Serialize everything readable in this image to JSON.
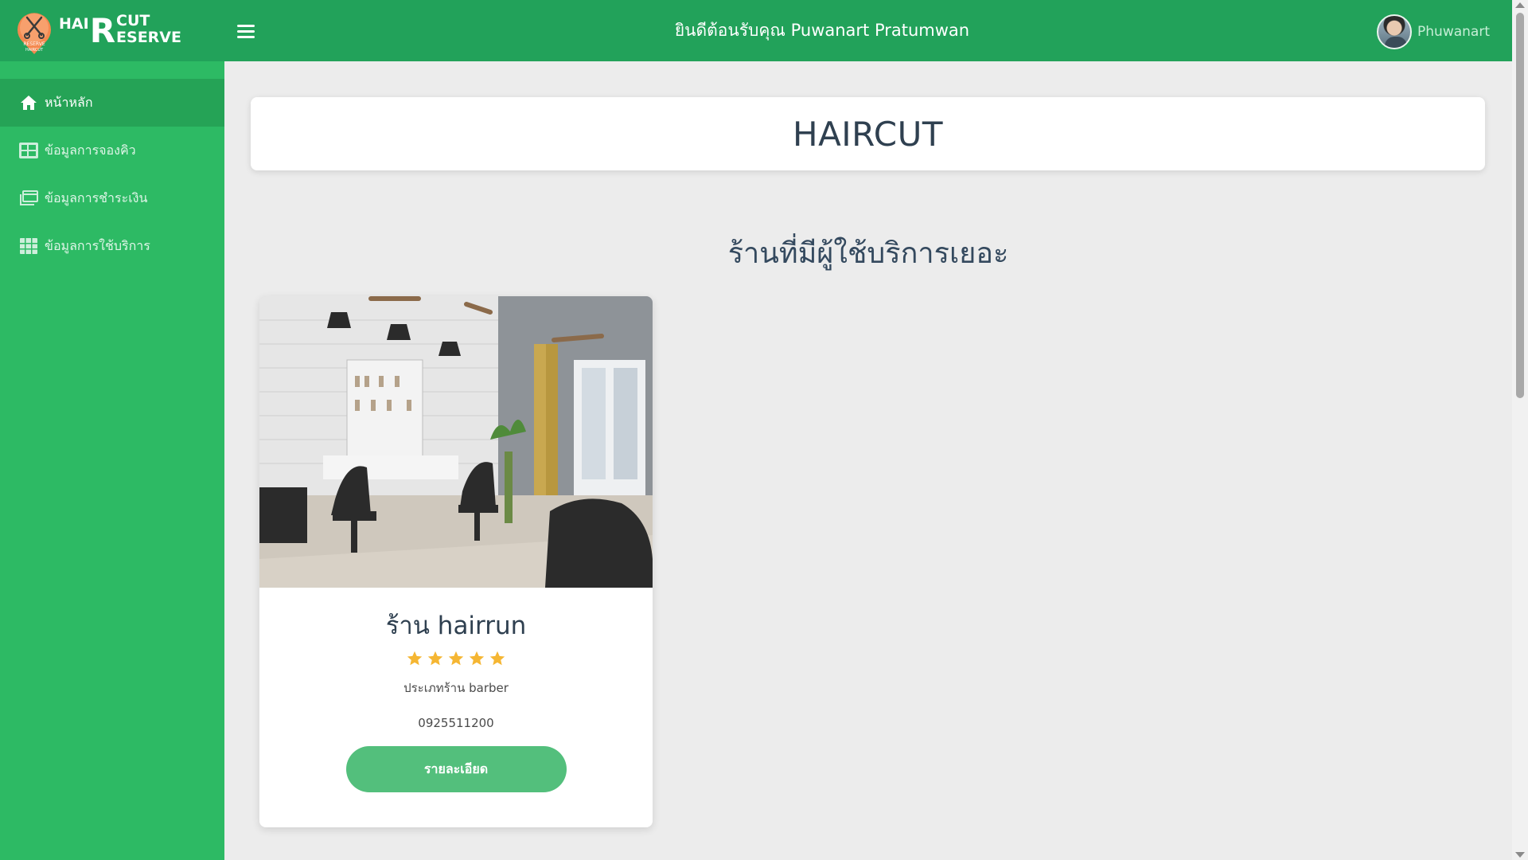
{
  "brand": {
    "part1": "HAI",
    "big_letter": "R",
    "part2": "CUT",
    "part3": "ESERVE",
    "badge_line1": "RESERVE",
    "badge_line2": "HAIRCUT"
  },
  "header": {
    "welcome": "ยินดีต้อนรับคุณ Puwanart Pratumwan",
    "user_name": "Phuwanart"
  },
  "sidebar": {
    "items": [
      {
        "label": "หน้าหลัก",
        "icon": "home-icon",
        "active": true
      },
      {
        "label": "ข้อมูลการจองคิว",
        "icon": "table-icon",
        "active": false
      },
      {
        "label": "ข้อมูลการชำระเงิน",
        "icon": "payment-icon",
        "active": false
      },
      {
        "label": "ข้อมูลการใช้บริการ",
        "icon": "grid-icon",
        "active": false
      }
    ]
  },
  "main": {
    "title": "HAIRCUT",
    "section_title": "ร้านที่มีผู้ใช้บริการเยอะ",
    "shop": {
      "name": "ร้าน hairrun",
      "rating": 5,
      "rating_max": 5,
      "type": "ประเภทร้าน barber",
      "phone": "0925511200",
      "button": "รายละเอียด"
    }
  },
  "colors": {
    "header": "#22a25a",
    "sidebar": "#2dba64",
    "sidebar_active": "#25a356",
    "button": "#53bf7c",
    "star": "#f5b633"
  }
}
